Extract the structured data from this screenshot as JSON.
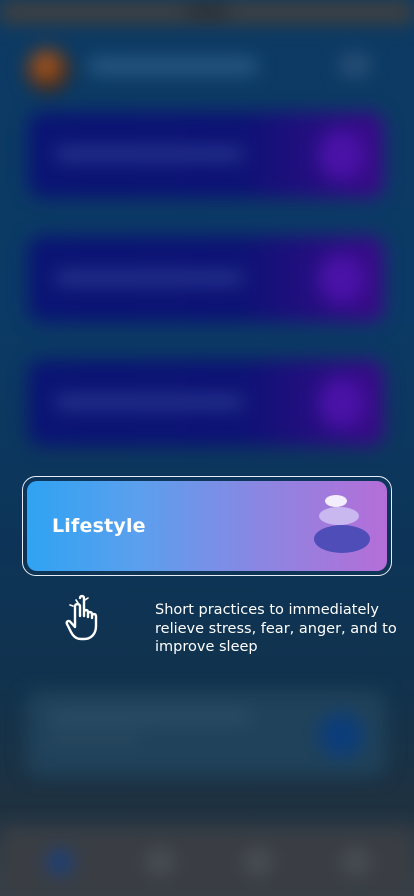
{
  "overlay": {
    "card_label": "Lifestyle",
    "hint": "Short practices to immediately relieve stress, fear, anger, and to improve sleep",
    "pointer_icon": "hand-pointer-icon",
    "card_icon": "balancing-stones-icon"
  },
  "colors": {
    "card_gradient_start": "#2fa3f2",
    "card_gradient_end": "#b56ed8",
    "frame": "#e8eef5",
    "text": "#ffffff"
  }
}
